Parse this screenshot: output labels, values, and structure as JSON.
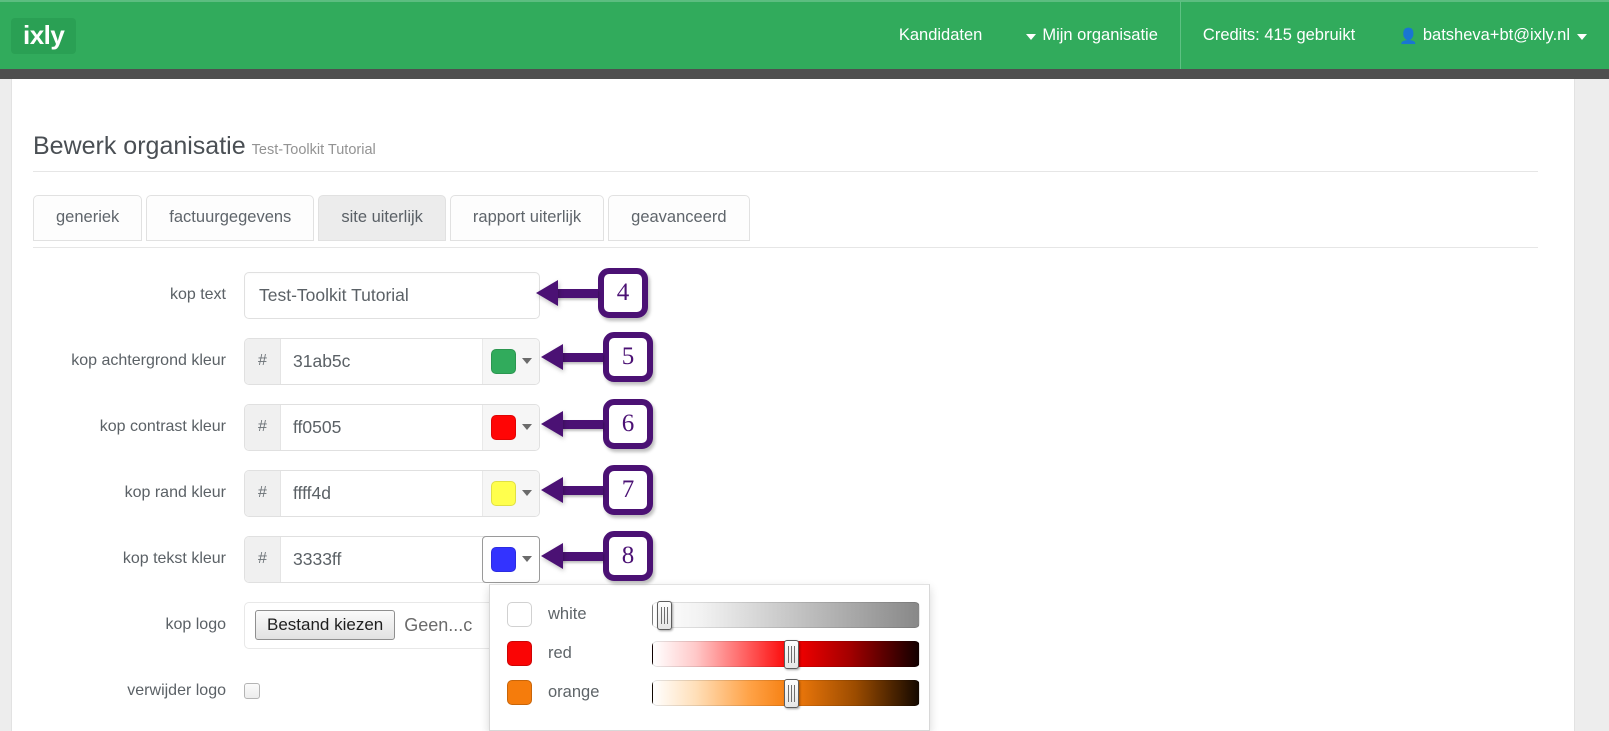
{
  "navbar": {
    "brand": "ixly",
    "links": [
      {
        "label": "Kandidaten",
        "caret": false
      },
      {
        "label": "Mijn organisatie",
        "caret": true
      }
    ],
    "credits": "Credits: 415 gebruikt",
    "user": "batsheva+bt@ixly.nl",
    "brand_color": "#31ab5c"
  },
  "page": {
    "title": "Bewerk organisatie",
    "subtitle": "Test-Toolkit Tutorial"
  },
  "tabs": [
    {
      "label": "generiek",
      "active": false
    },
    {
      "label": "factuurgegevens",
      "active": false
    },
    {
      "label": "site uiterlijk",
      "active": true
    },
    {
      "label": "rapport uiterlijk",
      "active": false
    },
    {
      "label": "geavanceerd",
      "active": false
    }
  ],
  "form": {
    "rows": [
      {
        "type": "text",
        "label": "kop text",
        "value": "Test-Toolkit Tutorial",
        "placeholder": "",
        "callout": "4"
      },
      {
        "type": "color",
        "label": "kop achtergrond kleur",
        "prefix": "#",
        "value": "31ab5c",
        "swatch": "#31ab5c",
        "open": false,
        "callout": "5"
      },
      {
        "type": "color",
        "label": "kop contrast kleur",
        "prefix": "#",
        "value": "ff0505",
        "swatch": "#ff0505",
        "open": false,
        "callout": "6"
      },
      {
        "type": "color",
        "label": "kop rand kleur",
        "prefix": "#",
        "value": "ffff4d",
        "swatch": "#ffff4d",
        "open": false,
        "callout": "7"
      },
      {
        "type": "color",
        "label": "kop tekst kleur",
        "prefix": "#",
        "value": "3333ff",
        "swatch": "#3333ff",
        "open": true,
        "callout": "8"
      },
      {
        "type": "file",
        "label": "kop logo",
        "button": "Bestand kiezen",
        "filename": "Geen...c",
        "callout": ""
      },
      {
        "type": "checkbox",
        "label": "verwijder logo",
        "checked": false,
        "callout": ""
      }
    ]
  },
  "color_picker": {
    "rows": [
      {
        "name": "white",
        "swatch": "#ffffff",
        "track_from": "#ffffff",
        "track_to": "#888888",
        "thumb_pct": 2
      },
      {
        "name": "red",
        "swatch": "#fa0505",
        "track_from": "#ffffff",
        "track_to": "#120000",
        "track_mid": "#ff0000",
        "thumb_pct": 49
      },
      {
        "name": "orange",
        "swatch": "#f57c0c",
        "track_from": "#ffffff",
        "track_to": "#140800",
        "track_mid": "#f57c0c",
        "thumb_pct": 49
      }
    ]
  },
  "annotations": {
    "accent": "#4b1174",
    "numbers": [
      "4",
      "5",
      "6",
      "7",
      "8"
    ]
  }
}
